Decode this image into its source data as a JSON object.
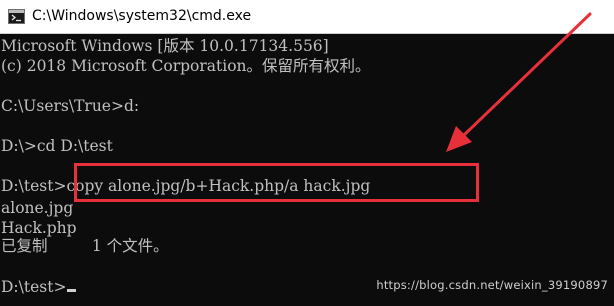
{
  "window": {
    "title": "C:\\Windows\\system32\\cmd.exe",
    "icon": "cmd-console-icon"
  },
  "console": {
    "lines": [
      "Microsoft Windows [版本 10.0.17134.556]",
      "(c) 2018 Microsoft Corporation。保留所有权利。",
      "",
      "C:\\Users\\True>d:",
      "",
      "D:\\>cd D:\\test",
      "",
      "D:\\test>copy alone.jpg/b+Hack.php/a hack.jpg",
      "alone.jpg",
      "Hack.php",
      "已复制         1 个文件。",
      "",
      "D:\\test>"
    ]
  },
  "annotations": {
    "highlight_color": "#e8303b",
    "arrow_color": "#e8303b"
  },
  "watermark": {
    "text": "https://blog.csdn.net/weixin_39190897"
  }
}
